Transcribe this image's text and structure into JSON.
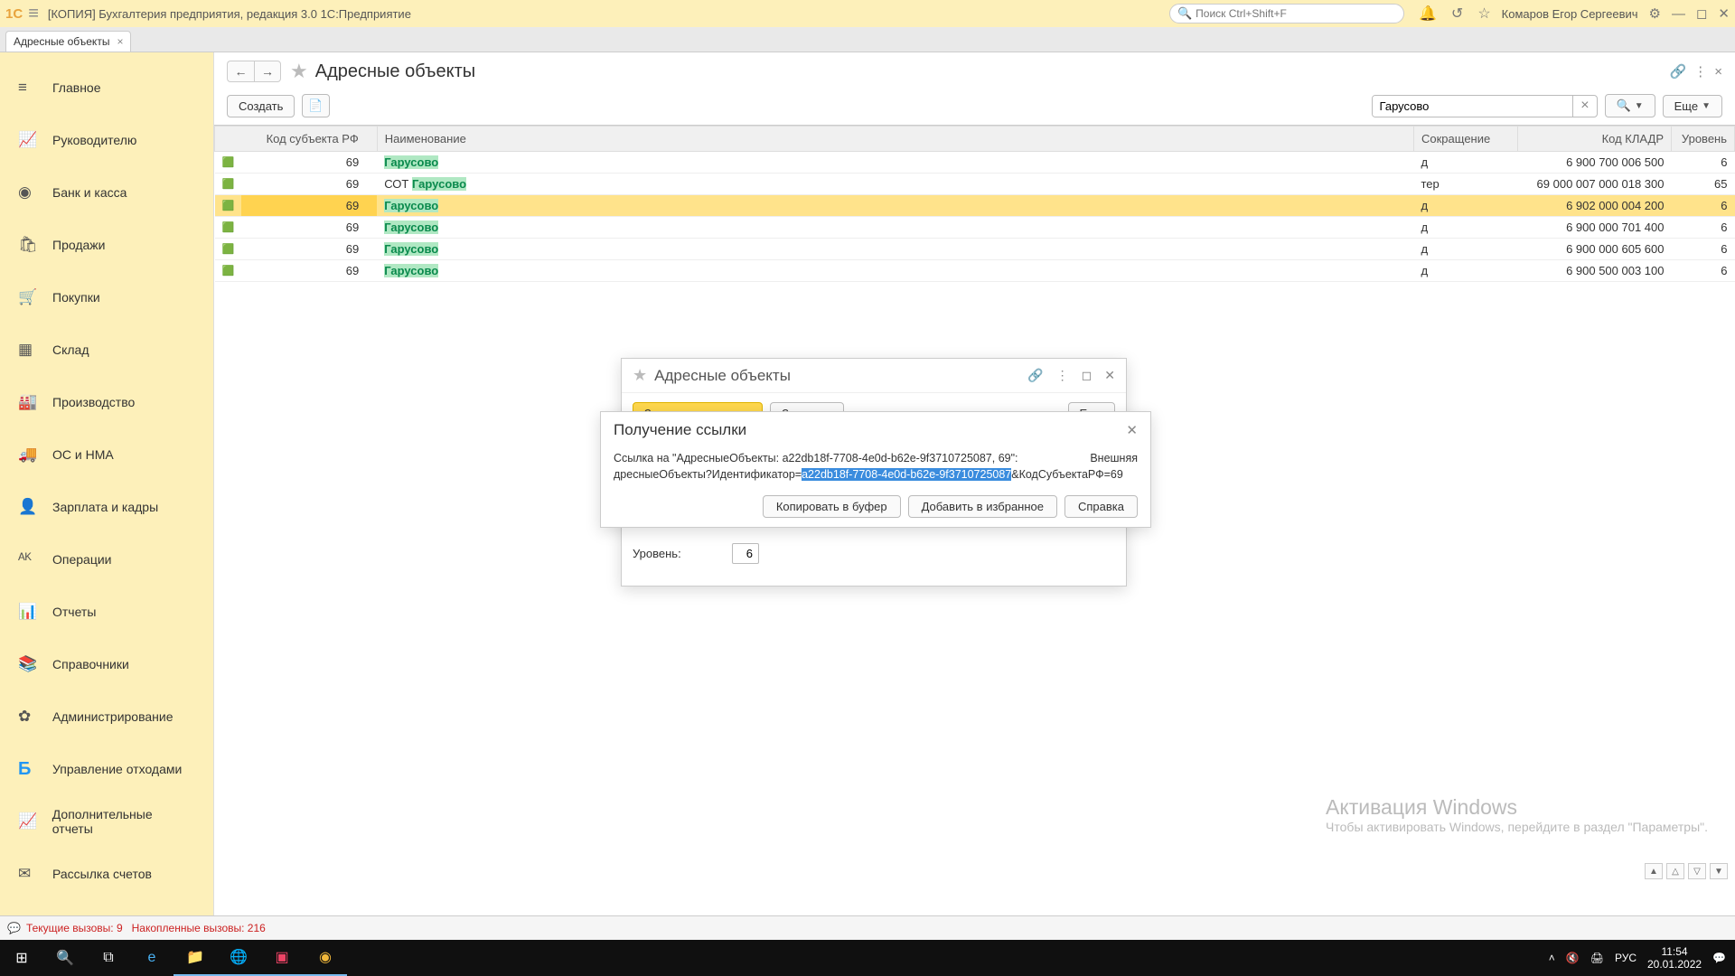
{
  "titlebar": {
    "logo": "1С",
    "title": "[КОПИЯ] Бухгалтерия предприятия, редакция 3.0 1С:Предприятие",
    "search_placeholder": "Поиск Ctrl+Shift+F",
    "user": "Комаров Егор Сергеевич"
  },
  "tabs": [
    {
      "label": "Адресные объекты"
    }
  ],
  "sidebar": {
    "items": [
      {
        "icon": "≡",
        "label": "Главное"
      },
      {
        "icon": "📈",
        "label": "Руководителю"
      },
      {
        "icon": "◉",
        "label": "Банк и касса"
      },
      {
        "icon": "🛍",
        "label": "Продажи"
      },
      {
        "icon": "🛒",
        "label": "Покупки"
      },
      {
        "icon": "▦",
        "label": "Склад"
      },
      {
        "icon": "🏭",
        "label": "Производство"
      },
      {
        "icon": "🚚",
        "label": "ОС и НМА"
      },
      {
        "icon": "👤",
        "label": "Зарплата и кадры"
      },
      {
        "icon": "ᴬᴷ",
        "label": "Операции"
      },
      {
        "icon": "📊",
        "label": "Отчеты"
      },
      {
        "icon": "📚",
        "label": "Справочники"
      },
      {
        "icon": "✿",
        "label": "Администрирование"
      },
      {
        "icon": "Б",
        "label": "Управление отходами",
        "b5": true
      },
      {
        "icon": "📈",
        "label": "Дополнительные отчеты"
      },
      {
        "icon": "✉",
        "label": "Рассылка счетов"
      }
    ]
  },
  "page": {
    "title": "Адресные объекты",
    "create": "Создать",
    "search_value": "Гарусово",
    "more": "Еще"
  },
  "table": {
    "columns": {
      "code": "Код субъекта РФ",
      "name": "Наименование",
      "abbr": "Сокращение",
      "kladr": "Код КЛАДР",
      "level": "Уровень"
    },
    "rows": [
      {
        "code": "69",
        "name": "Гарусово",
        "abbr": "д",
        "kladr": "6 900 700 006 500",
        "level": "6"
      },
      {
        "code": "69",
        "name_pre": "СОТ ",
        "name": "Гарусово",
        "abbr": "тер",
        "kladr": "69 000 007 000 018 300",
        "level": "65"
      },
      {
        "code": "69",
        "name": "Гарусово",
        "abbr": "д",
        "kladr": "6 902 000 004 200",
        "level": "6",
        "selected": true
      },
      {
        "code": "69",
        "name": "Гарусово",
        "abbr": "д",
        "kladr": "6 900 000 701 400",
        "level": "6"
      },
      {
        "code": "69",
        "name": "Гарусово",
        "abbr": "д",
        "kladr": "6 900 000 605 600",
        "level": "6"
      },
      {
        "code": "69",
        "name": "Гарусово",
        "abbr": "д",
        "kladr": "6 900 500 003 100",
        "level": "6"
      }
    ]
  },
  "card_under": {
    "title": "Адресные объекты",
    "save_close": "Записать и закрыть",
    "save": "Записать",
    "more": "Еще",
    "level_label": "Уровень:",
    "level_value": "6"
  },
  "dialog": {
    "title": "Получение ссылки",
    "link_label_pre": "Ссылка на \"АдресныеОбъекты: a22db18f-7708-4e0d-b62e-9f3710725087, 69\":",
    "external": "Внешняя",
    "url_pre": "дресныеОбъекты?Идентификатор=",
    "url_sel": "a22db18f-7708-4e0d-b62e-9f3710725087",
    "url_post": "&КодСубъектаРФ=69",
    "copy": "Копировать в буфер",
    "favorite": "Добавить в избранное",
    "help": "Справка"
  },
  "watermark": {
    "title": "Активация Windows",
    "sub": "Чтобы активировать Windows, перейдите в раздел \"Параметры\"."
  },
  "statusbar": {
    "current": "Текущие вызовы: 9",
    "accum": "Накопленные вызовы: 216"
  },
  "taskbar": {
    "lang": "РУС",
    "time": "11:54",
    "date": "20.01.2022"
  }
}
